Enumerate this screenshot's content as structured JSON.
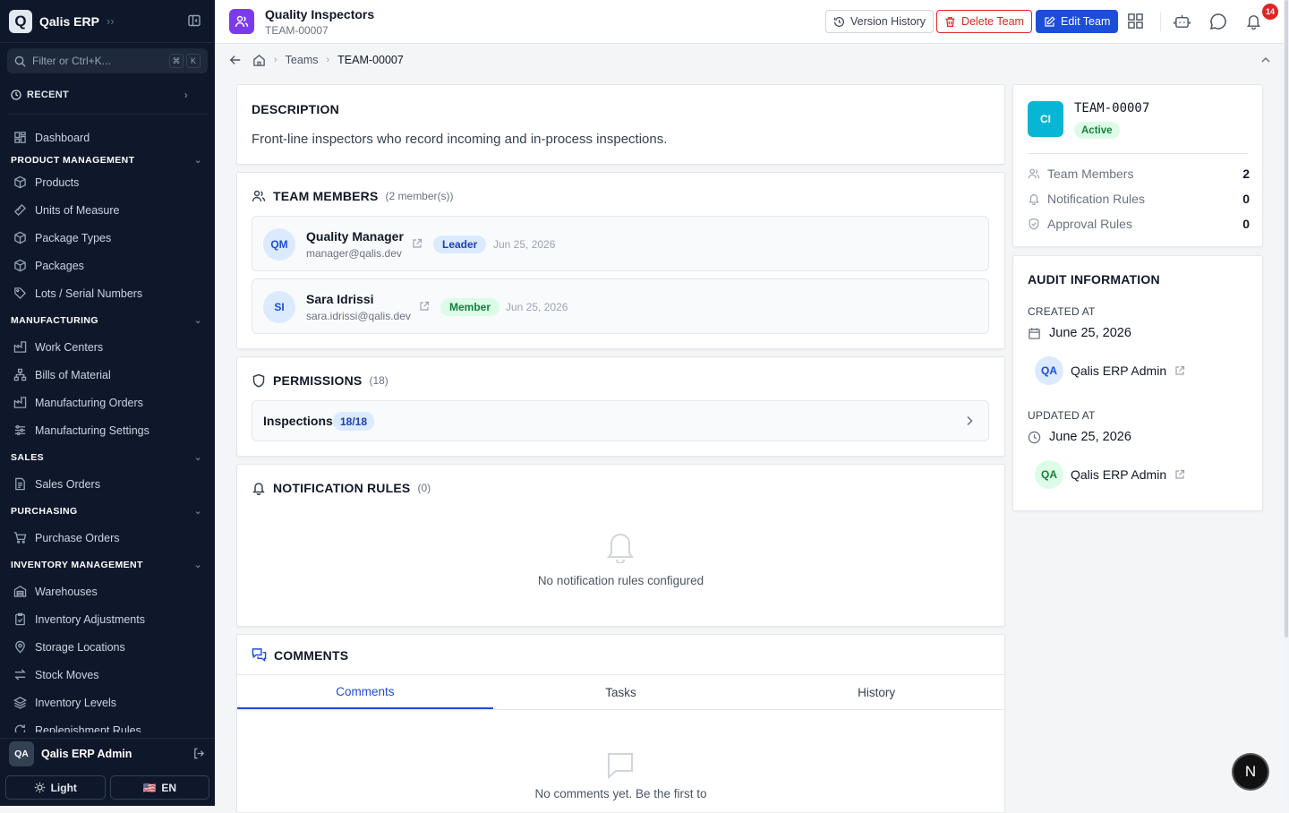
{
  "sidebar": {
    "app_name": "Qalis ERP",
    "logo_letter": "Q",
    "filter_placeholder": "Filter or Ctrl+K...",
    "kbd_cmd": "⌘",
    "kbd_k": "K",
    "recent_label": "RECENT",
    "dashboard": "Dashboard",
    "sections": {
      "product": "PRODUCT MANAGEMENT",
      "manufacturing": "MANUFACTURING",
      "sales": "SALES",
      "purchasing": "PURCHASING",
      "inventory": "INVENTORY MANAGEMENT"
    },
    "items": {
      "products": "Products",
      "uom": "Units of Measure",
      "package_types": "Package Types",
      "packages": "Packages",
      "lots": "Lots / Serial Numbers",
      "work_centers": "Work Centers",
      "bom": "Bills of Material",
      "mo": "Manufacturing Orders",
      "mfg_settings": "Manufacturing Settings",
      "sales_orders": "Sales Orders",
      "purchase_orders": "Purchase Orders",
      "warehouses": "Warehouses",
      "inv_adjustments": "Inventory Adjustments",
      "storage_locations": "Storage Locations",
      "stock_moves": "Stock Moves",
      "inventory_levels": "Inventory Levels",
      "replenishment": "Replenishment Rules"
    },
    "user_initials": "QA",
    "user_name": "Qalis ERP Admin",
    "theme_label": "Light",
    "lang_flag": "🇺🇸",
    "lang_label": "EN"
  },
  "header": {
    "title": "Quality Inspectors",
    "subtitle": "TEAM-00007",
    "version_history": "Version History",
    "delete_team": "Delete Team",
    "edit_team": "Edit Team",
    "notification_count": "14"
  },
  "breadcrumb": {
    "teams": "Teams",
    "current": "TEAM-00007"
  },
  "description": {
    "title": "DESCRIPTION",
    "text": "Front-line inspectors who record incoming and in-process inspections."
  },
  "members": {
    "title": "TEAM MEMBERS",
    "count": "(2 member(s))",
    "list": [
      {
        "initials": "QM",
        "name": "Quality Manager",
        "email": "manager@qalis.dev",
        "role": "Leader",
        "date": "Jun 25, 2026"
      },
      {
        "initials": "SI",
        "name": "Sara Idrissi",
        "email": "sara.idrissi@qalis.dev",
        "role": "Member",
        "date": "Jun 25, 2026"
      }
    ]
  },
  "permissions": {
    "title": "PERMISSIONS",
    "count": "(18)",
    "module": "Inspections",
    "module_count": "18/18"
  },
  "notification_rules": {
    "title": "NOTIFICATION RULES",
    "count": "(0)",
    "empty": "No notification rules configured"
  },
  "comments": {
    "title": "COMMENTS",
    "tabs": [
      "Comments",
      "Tasks",
      "History"
    ],
    "empty": "No comments yet. Be the first to"
  },
  "summary": {
    "avatar": "CI",
    "code": "TEAM-00007",
    "status": "Active",
    "stats": [
      {
        "label": "Team Members",
        "value": "2"
      },
      {
        "label": "Notification Rules",
        "value": "0"
      },
      {
        "label": "Approval Rules",
        "value": "0"
      }
    ]
  },
  "audit": {
    "title": "AUDIT INFORMATION",
    "created_label": "CREATED AT",
    "created_date": "June 25, 2026",
    "created_by_initials": "QA",
    "created_by": "Qalis ERP Admin",
    "updated_label": "UPDATED AT",
    "updated_date": "June 25, 2026",
    "updated_by_initials": "QA",
    "updated_by": "Qalis ERP Admin"
  },
  "fab_letter": "N",
  "colors": {
    "sidebar_bg": "#0f172a",
    "primary": "#1d4ed8",
    "danger": "#dc2626",
    "team_icon": "#7c3aed",
    "summary_avatar": "#06b6d4",
    "success": "#15803d"
  }
}
